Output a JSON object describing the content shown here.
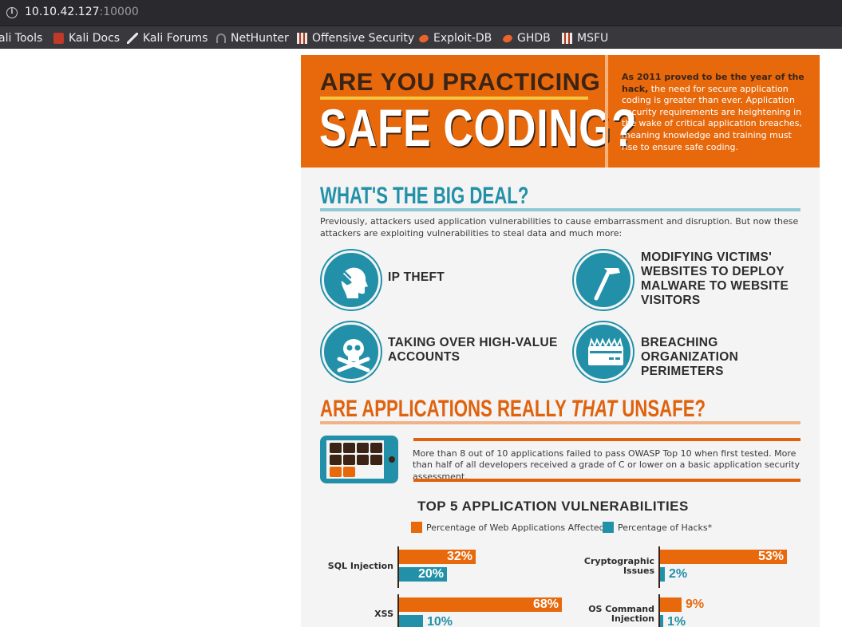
{
  "browser": {
    "url_host": "10.10.42.127",
    "url_port": ":10000",
    "bookmarks": [
      {
        "label": "ali Tools",
        "icon": "kali-tools-icon"
      },
      {
        "label": "Kali Docs",
        "icon": "kali-docs-icon"
      },
      {
        "label": "Kali Forums",
        "icon": "kali-forums-icon"
      },
      {
        "label": "NetHunter",
        "icon": "nethunter-icon"
      },
      {
        "label": "Offensive Security",
        "icon": "offensive-security-icon"
      },
      {
        "label": "Exploit-DB",
        "icon": "exploit-db-icon"
      },
      {
        "label": "GHDB",
        "icon": "ghdb-icon"
      },
      {
        "label": "MSFU",
        "icon": "msfu-icon"
      }
    ]
  },
  "infographic": {
    "hero": {
      "line1": "ARE YOU PRACTICING",
      "line2": "SAFE CODING?",
      "blurb_bold": "As 2011 proved to be the year of the hack,",
      "blurb_rest": " the need for secure application coding is greater than ever. Application security requirements are heightening in the wake of critical application breaches, meaning knowledge and training must rise to ensure safe coding."
    },
    "big_deal": {
      "title": "WHAT'S THE BIG DEAL?",
      "intro": "Previously, attackers used application vulnerabilities to cause embarrassment and disruption. But now these attackers are exploiting vulnerabilities to steal data and much more:",
      "threats": [
        {
          "label": "IP THEFT",
          "icon": "head-hand-icon"
        },
        {
          "label": "MODIFYING VICTIMS' WEBSITES TO DEPLOY MALWARE TO WEBSITE VISITORS",
          "icon": "hammer-icon"
        },
        {
          "label": "TAKING OVER HIGH-VALUE ACCOUNTS",
          "icon": "skull-crossbones-icon"
        },
        {
          "label": "BREACHING ORGANIZATION PERIMETERS",
          "icon": "brick-wall-icon"
        }
      ]
    },
    "unsafe": {
      "title_pre": "ARE APPLICATIONS REALLY ",
      "title_em": "THAT",
      "title_post": " UNSAFE?",
      "stat": "More than 8 out of 10 applications failed to pass OWASP Top 10 when first tested. More than half of all developers received a grade of C or lower on a basic application security assessment."
    },
    "colors": {
      "orange": "#e8690c",
      "teal": "#2290a8",
      "brown": "#3b2415"
    },
    "chart_data": {
      "type": "bar",
      "title": "TOP 5 APPLICATION VULNERABILITIES",
      "series_names": [
        "Percentage of Web Applications Affected",
        "Percentage of Hacks*"
      ],
      "categories": [
        "SQL Injection",
        "Cryptographic Issues",
        "XSS",
        "OS Command Injection"
      ],
      "series": [
        {
          "name": "Percentage of Web Applications Affected",
          "values": [
            32,
            53,
            68,
            9
          ]
        },
        {
          "name": "Percentage of Hacks*",
          "values": [
            20,
            2,
            10,
            1
          ]
        }
      ],
      "value_labels": {
        "applications": [
          "32%",
          "53%",
          "68%",
          "9%"
        ],
        "hacks": [
          "20%",
          "2%",
          "10%",
          "1%"
        ]
      },
      "category_lines": [
        [
          "SQL Injection"
        ],
        [
          "Cryptographic",
          "Issues"
        ],
        [
          "XSS"
        ],
        [
          "OS Command",
          "Injection"
        ]
      ],
      "legend_placement": "top-center"
    }
  }
}
